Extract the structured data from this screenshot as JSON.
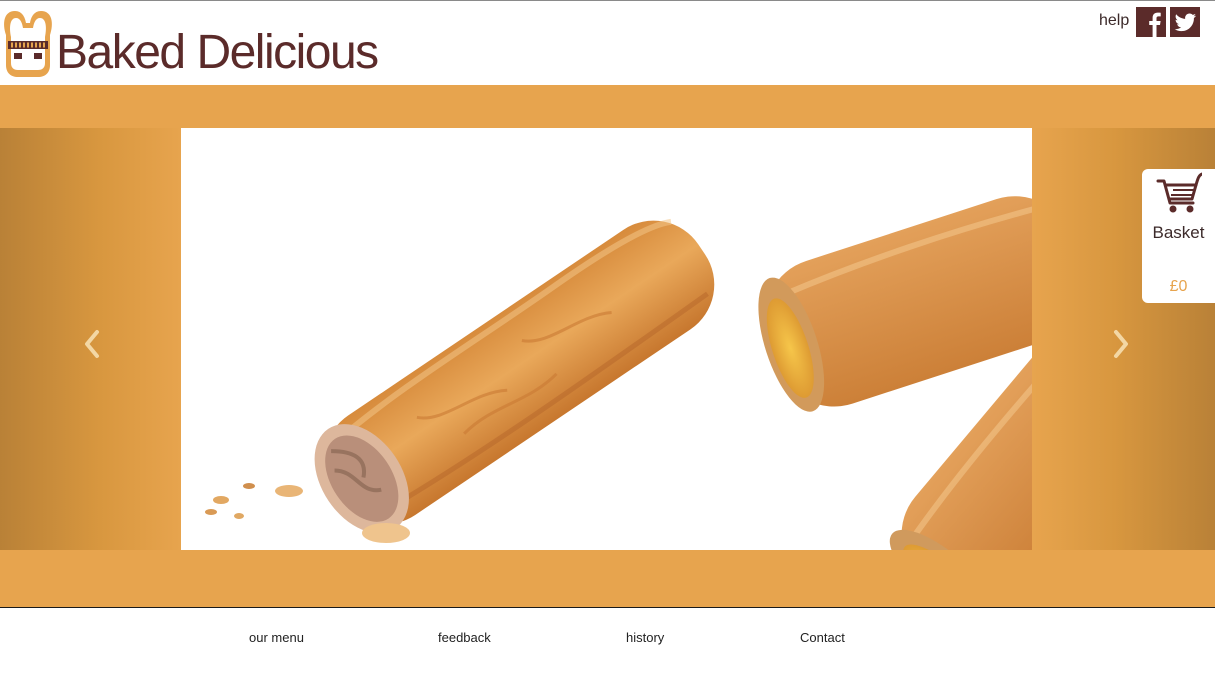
{
  "header": {
    "brand_name": "Baked Delicious",
    "help_link": "help",
    "social": [
      {
        "icon": "facebook-icon"
      },
      {
        "icon": "twitter-icon"
      }
    ]
  },
  "carousel": {
    "prev_icon": "chevron-left-icon",
    "next_icon": "chevron-right-icon",
    "slide_subject": "sausage rolls"
  },
  "basket": {
    "icon": "shopping-cart-icon",
    "label": "Basket",
    "total": "£0"
  },
  "nav": {
    "items": [
      {
        "label": "our menu"
      },
      {
        "label": "feedback"
      },
      {
        "label": "history"
      },
      {
        "label": "Contact"
      }
    ]
  },
  "colors": {
    "brand_brown": "#5b2b2a",
    "band_orange": "#e7a44e",
    "side_gradient_dark": "#b98137",
    "basket_total": "#e7a44e"
  }
}
